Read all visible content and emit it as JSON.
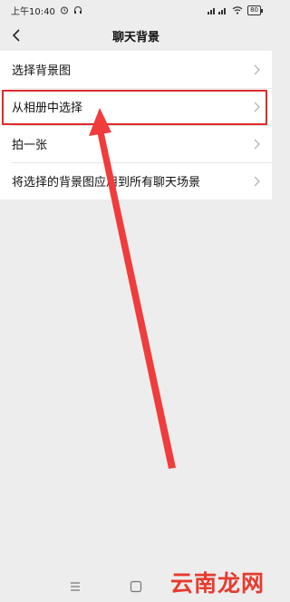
{
  "status_bar": {
    "time": "上午10:40",
    "battery": "80"
  },
  "header": {
    "title": "聊天背景"
  },
  "menu": {
    "items": [
      {
        "label": "选择背景图"
      },
      {
        "label": "从相册中选择"
      },
      {
        "label": "拍一张"
      },
      {
        "label": "将选择的背景图应用到所有聊天场景"
      }
    ]
  },
  "annotation": {
    "highlight_color": "#e02a2a"
  },
  "watermark": {
    "text": "云南龙网"
  },
  "icons": [
    "alarm-icon",
    "headphones-icon",
    "signal-icon",
    "wifi-icon",
    "battery-icon",
    "back-icon",
    "chevron-right-icon",
    "menu-nav-icon",
    "home-nav-icon"
  ]
}
